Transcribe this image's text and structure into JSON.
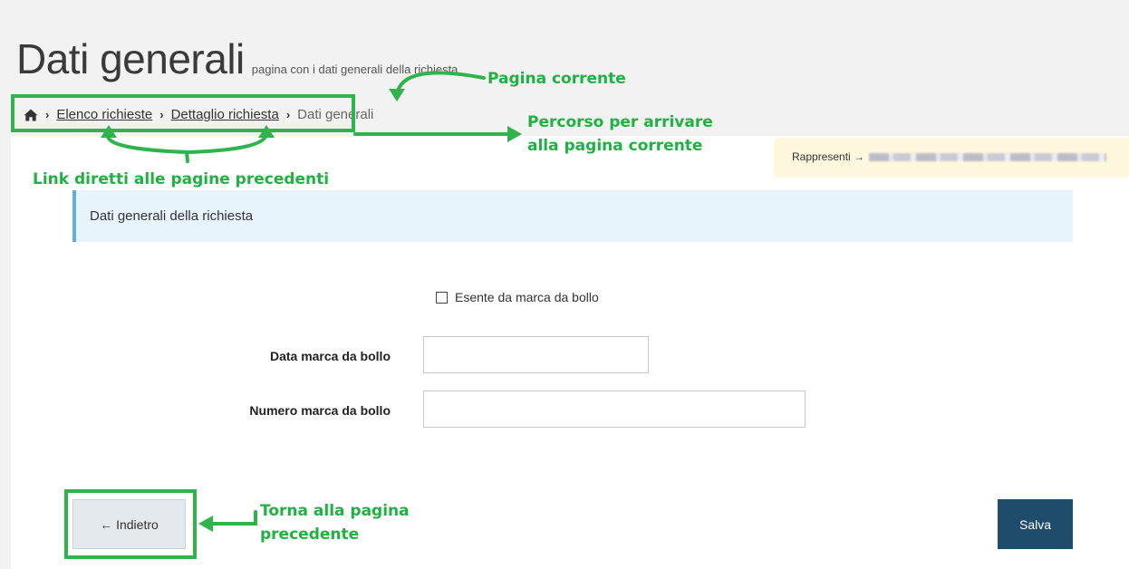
{
  "header": {
    "title": "Dati generali",
    "subtitle": "pagina con i dati generali della richiesta"
  },
  "breadcrumb": {
    "home_icon": "home-icon",
    "items": [
      "Elenco richieste",
      "Dettaglio richiesta"
    ],
    "current": "Dati generali"
  },
  "represent": {
    "label": "Rappresenti",
    "arrow": "→"
  },
  "panel": {
    "title": "Dati generali della richiesta"
  },
  "form": {
    "exempt_label": "Esente da marca da bollo",
    "exempt_checked": false,
    "date_label": "Data marca da bollo",
    "date_value": "",
    "number_label": "Numero marca da bollo",
    "number_value": ""
  },
  "buttons": {
    "back_label": "← Indietro",
    "save_label": "Salva"
  },
  "annotations": {
    "current_page": "Pagina corrente",
    "path_line1": "Percorso per arrivare",
    "path_line2": "alla pagina corrente",
    "direct_links": "Link diretti alle pagine precedenti",
    "back_line1": "Torna alla pagina",
    "back_line2": "precedente"
  },
  "colors": {
    "annotation_green": "#2eb44a",
    "save_button": "#1f4c6d",
    "panel_bg": "#e7f4fb",
    "panel_accent": "#5fb0dd",
    "represent_bg": "#fdf8dd"
  }
}
